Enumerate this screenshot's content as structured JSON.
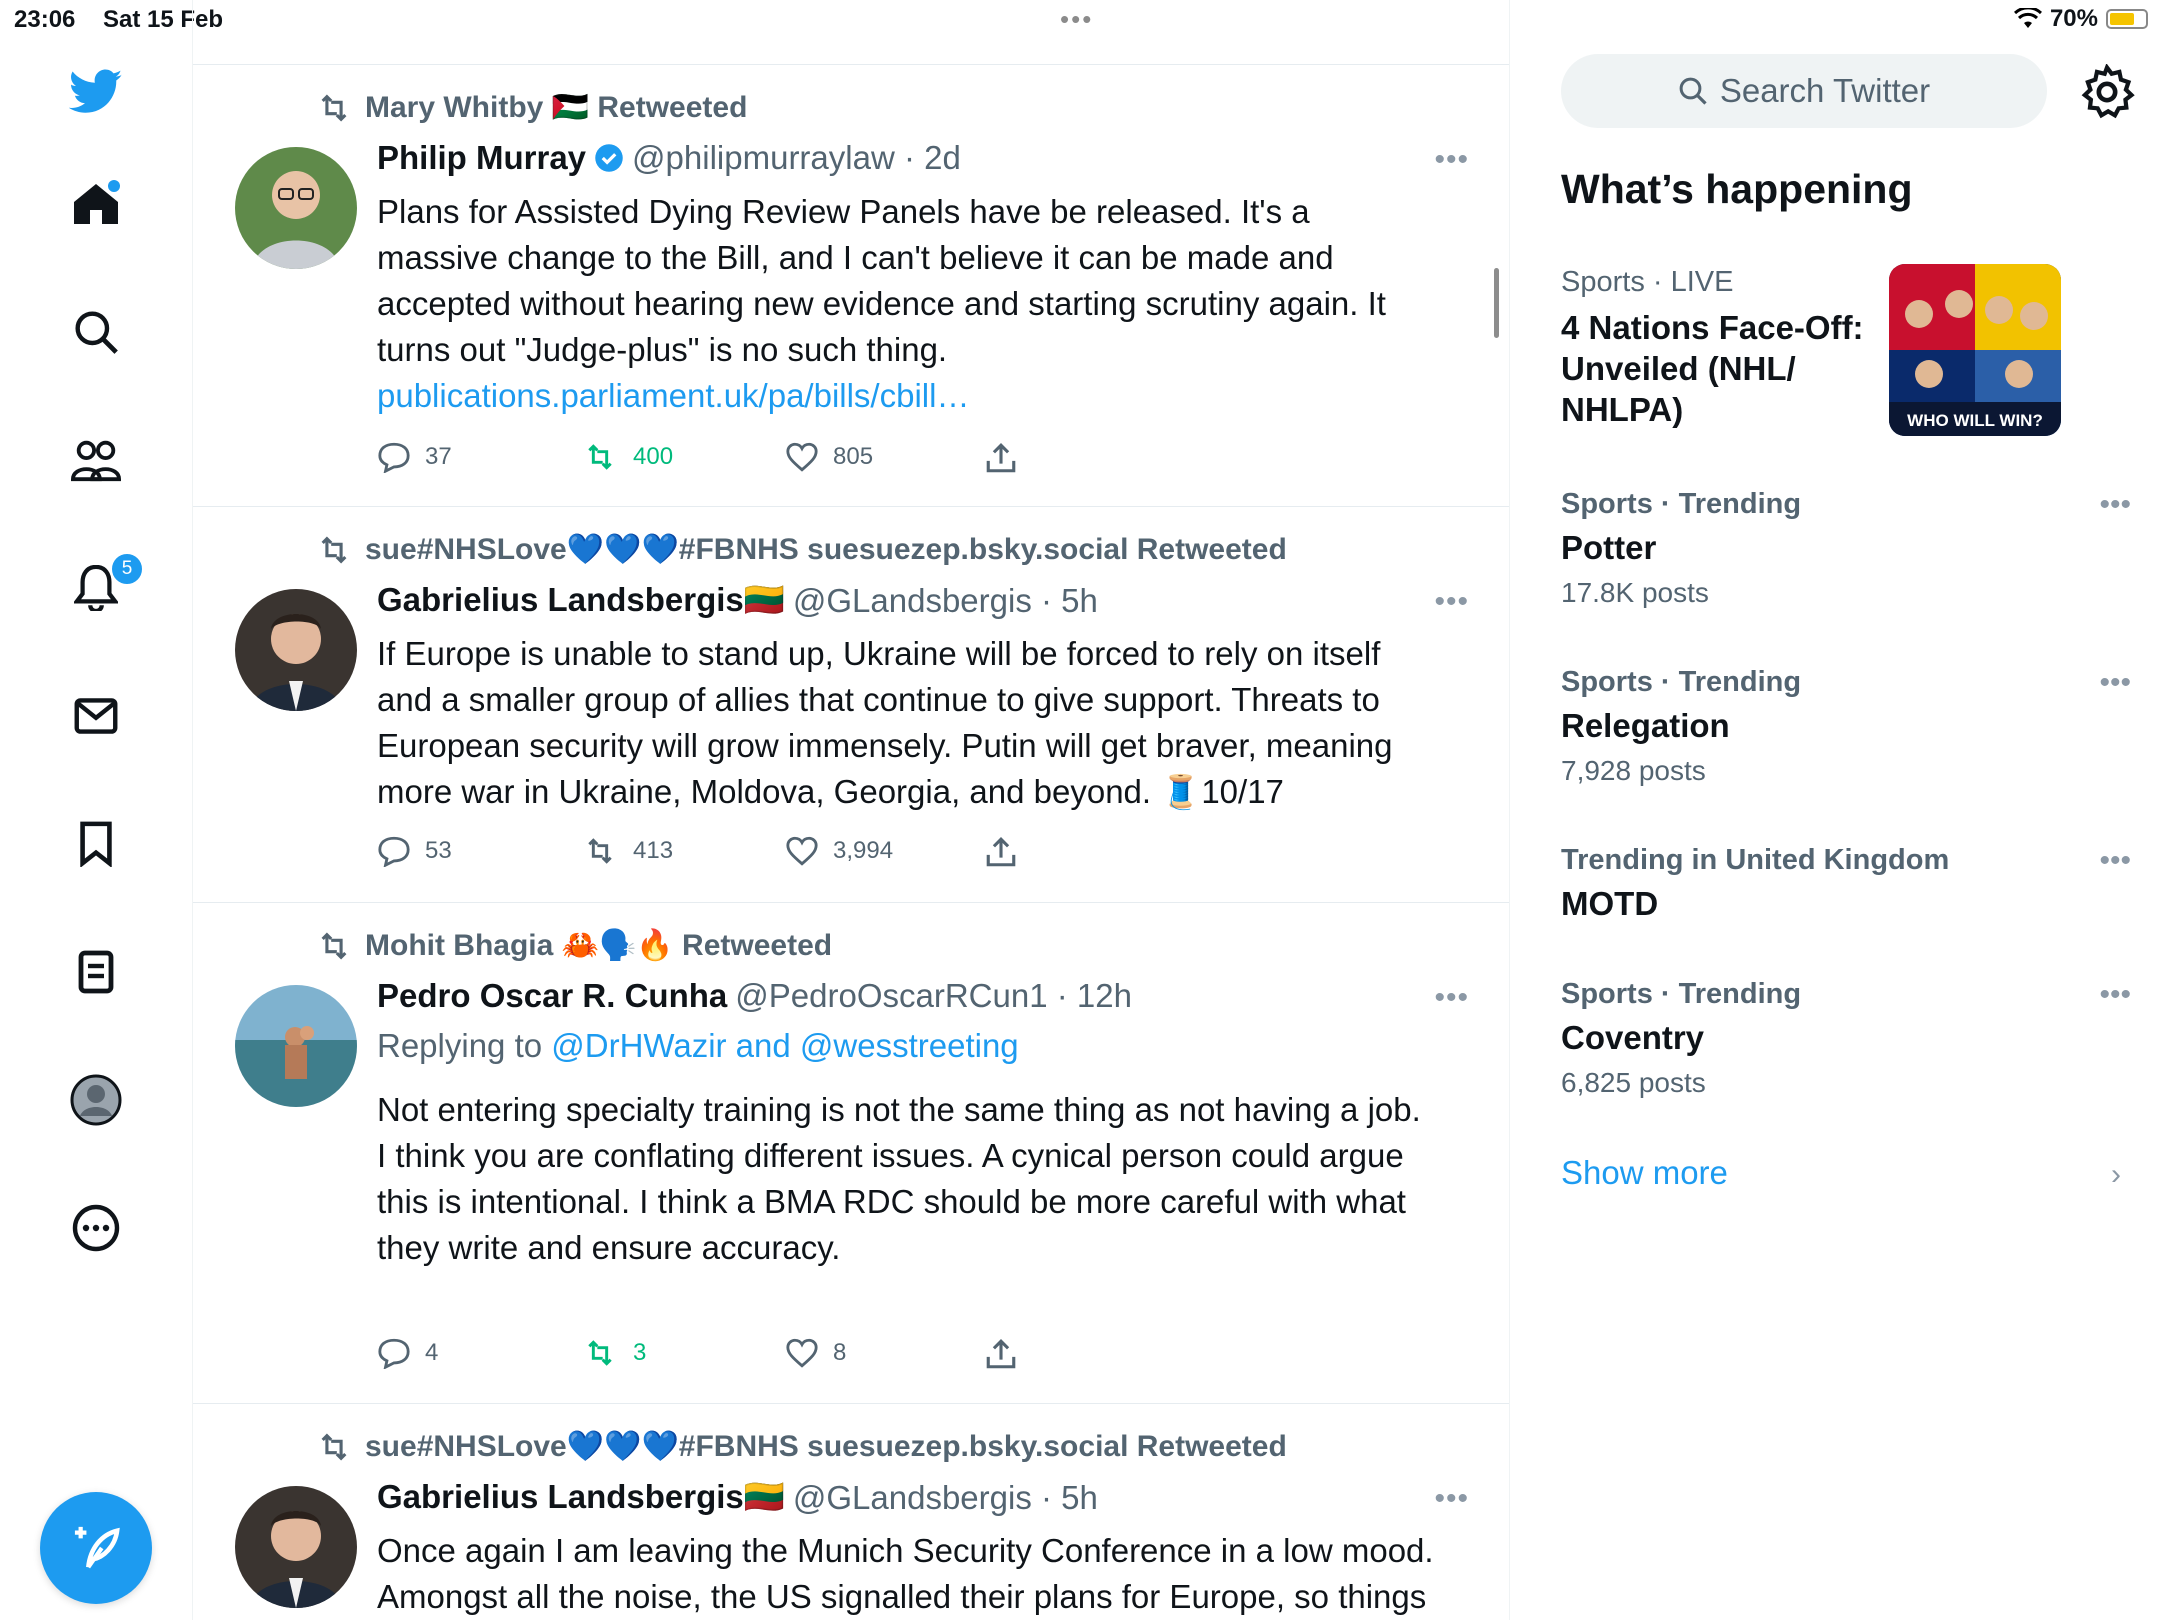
{
  "status_bar": {
    "time": "23:06",
    "date": "Sat 15 Feb",
    "battery": "70%",
    "battery_level": 0.7
  },
  "nav": {
    "notifications_badge": "5",
    "items": [
      "home-icon",
      "search-icon",
      "communities-icon",
      "notifications-icon",
      "messages-icon",
      "bookmarks-icon",
      "lists-icon",
      "profile-icon",
      "more-icon"
    ]
  },
  "tweets": [
    {
      "retweeted_by": "Mary Whitby 🇵🇸 Retweeted",
      "name": "Philip Murray",
      "verified": true,
      "handle": "@philipmurraylaw · 2d",
      "body": "Plans for Assisted Dying Review Panels have be released. It's a massive change to the Bill, and I can't believe it can be made and accepted without hearing new evidence and starting scrutiny again. It turns out \"Judge-plus\" is no such thing. ",
      "link": "publications.parliament.uk/pa/bills/cbill…",
      "replies": "37",
      "retweets": "400",
      "likes": "805",
      "retweeted": true
    },
    {
      "retweeted_by": "sue#NHSLove💙💙💙#FBNHS suesuezep.bsky.social Retweeted",
      "name": "Gabrielius Landsbergis🇱🇹",
      "handle": "@GLandsbergis · 5h",
      "body": "If Europe is unable to stand up, Ukraine will be forced to rely on itself and a smaller group of allies that continue to give support. Threats to European security will grow immensely. Putin will get braver, meaning more war in Ukraine, Moldova, Georgia, and beyond. 🧵10/17",
      "replies": "53",
      "retweets": "413",
      "likes": "3,994",
      "retweeted": false
    },
    {
      "retweeted_by": "Mohit Bhagia 🦀🗣️🔥 Retweeted",
      "name": "Pedro Oscar R. Cunha",
      "handle": "@PedroOscarRCun1 · 12h",
      "replying_label": "Replying to ",
      "replying_to": "@DrHWazir and @wesstreeting",
      "body": "Not entering specialty training is not the same thing as  not having a job.\nI think you are conflating different issues. A cynical person could argue this is intentional. I think a BMA RDC should be more careful with what they write and ensure accuracy.",
      "replies": "4",
      "retweets": "3",
      "likes": "8",
      "retweeted": true
    },
    {
      "retweeted_by": "sue#NHSLove💙💙💙#FBNHS suesuezep.bsky.social Retweeted",
      "name": "Gabrielius Landsbergis🇱🇹",
      "handle": "@GLandsbergis · 5h",
      "body": "Once again I am leaving the Munich Security Conference in a low mood. Amongst all the noise, the US signalled their plans for Europe, so things"
    }
  ],
  "sidebar": {
    "search_placeholder": "Search Twitter",
    "whats_happening": "What’s happening",
    "featured": {
      "meta": "Sports · LIVE",
      "title": "4 Nations Face-Off: Unveiled (NHL/ NHLPA)",
      "image_text": "WHO WILL WIN?"
    },
    "trends": [
      {
        "meta": "Sports · Trending",
        "name": "Potter",
        "count": "17.8K posts"
      },
      {
        "meta": "Sports · Trending",
        "name": "Relegation",
        "count": "7,928 posts"
      },
      {
        "meta": "Trending in United Kingdom",
        "name": "MOTD",
        "count": ""
      },
      {
        "meta": "Sports · Trending",
        "name": "Coventry",
        "count": "6,825 posts"
      }
    ],
    "show_more": "Show more"
  },
  "colors": {
    "accent": "#1d9bf0",
    "retweet_green": "#00ba7c",
    "secondary_text": "#536471"
  }
}
